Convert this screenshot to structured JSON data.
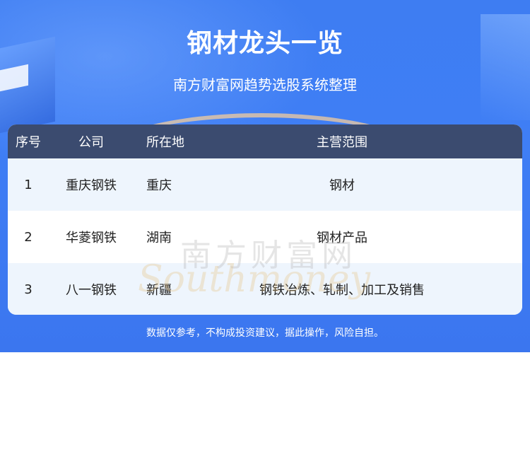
{
  "header": {
    "title": "钢材龙头一览",
    "subtitle": "南方财富网趋势选股系统整理"
  },
  "table": {
    "columns": [
      "序号",
      "公司",
      "所在地",
      "主营范围"
    ],
    "rows": [
      {
        "index": "1",
        "company": "重庆钢铁",
        "location": "重庆",
        "business": "钢材"
      },
      {
        "index": "2",
        "company": "华菱钢铁",
        "location": "湖南",
        "business": "钢材产品"
      },
      {
        "index": "3",
        "company": "八一钢铁",
        "location": "新疆",
        "business": "钢铁冶炼、轧制、加工及销售"
      }
    ]
  },
  "watermark": {
    "cn": "南方财富网",
    "en": "Southmoney"
  },
  "footer": {
    "disclaimer": "数据仅参考，不构成投资建议，据此操作，风险自担。"
  },
  "colors": {
    "banner": "#3e7df2",
    "table_header": "#3b4b6f",
    "row_alt": "#eef5fd"
  }
}
